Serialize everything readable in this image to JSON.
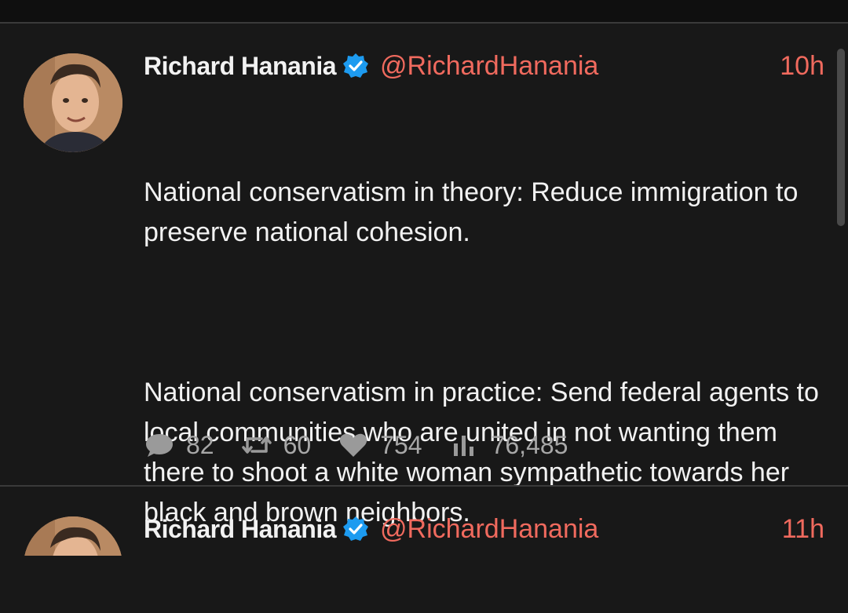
{
  "tweets": [
    {
      "author": "Richard Hanania",
      "handle": "@RichardHanania",
      "time": "10h",
      "paragraphs": [
        "National conservatism in theory: Reduce immigration to preserve national cohesion.",
        "National conservatism in practice: Send federal agents to local communities who are united in not wanting them there to shoot a white woman sympathetic towards her black and brown neighbors."
      ],
      "stats": {
        "replies": "82",
        "retweets": "60",
        "likes": "754",
        "views": "76,485"
      },
      "icons": {
        "reply": "speech-bubble-icon",
        "retweet": "retweet-icon",
        "like": "heart-icon",
        "views": "bar-chart-icon",
        "verified": "verified-badge-icon"
      }
    },
    {
      "author": "Richard Hanania",
      "handle": "@RichardHanania",
      "time": "11h"
    }
  ],
  "colors": {
    "background": "#181818",
    "accent": "#f06a5e",
    "verified": "#1d9bf0",
    "muted": "#9a9a9a"
  }
}
